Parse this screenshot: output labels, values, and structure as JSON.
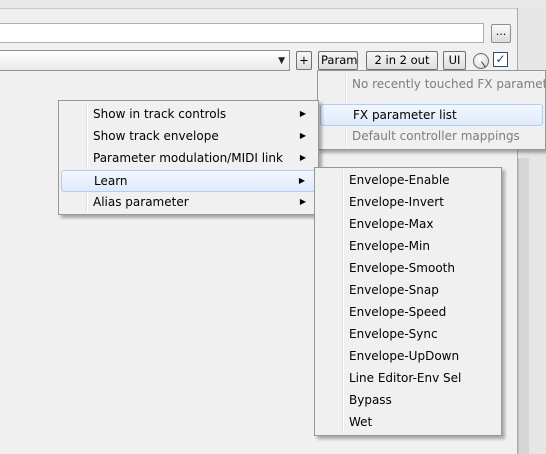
{
  "toolbar": {
    "browse_label": "...",
    "fx_select_arrow": "▼",
    "plus_label": "+",
    "param_label": "Param",
    "io_label": "2 in 2 out",
    "ui_label": "UI",
    "enable_checkbox_glyph": "✓"
  },
  "context_menu": {
    "items": [
      {
        "label": "Show in track controls",
        "submenu": "▶"
      },
      {
        "label": "Show track envelope",
        "submenu": "▶"
      },
      {
        "label": "Parameter modulation/MIDI link",
        "submenu": "▶"
      },
      {
        "label": "Learn",
        "submenu": "▶"
      },
      {
        "label": "Alias parameter",
        "submenu": "▶"
      }
    ]
  },
  "param_menu": {
    "items": [
      {
        "label": "No recently touched FX parameters"
      },
      {
        "label": "FX parameter list"
      },
      {
        "label": "Default controller mappings"
      }
    ]
  },
  "learn_submenu": {
    "items": [
      "Envelope-Enable",
      "Envelope-Invert",
      "Envelope-Max",
      "Envelope-Min",
      "Envelope-Smooth",
      "Envelope-Snap",
      "Envelope-Speed",
      "Envelope-Sync",
      "Envelope-UpDown",
      "Line Editor-Env Sel",
      "Bypass",
      "Wet"
    ]
  },
  "colors": {
    "menu_bg": "#f0f0f0",
    "highlight_border": "#aecff7",
    "disabled_text": "#7d7d7d"
  }
}
